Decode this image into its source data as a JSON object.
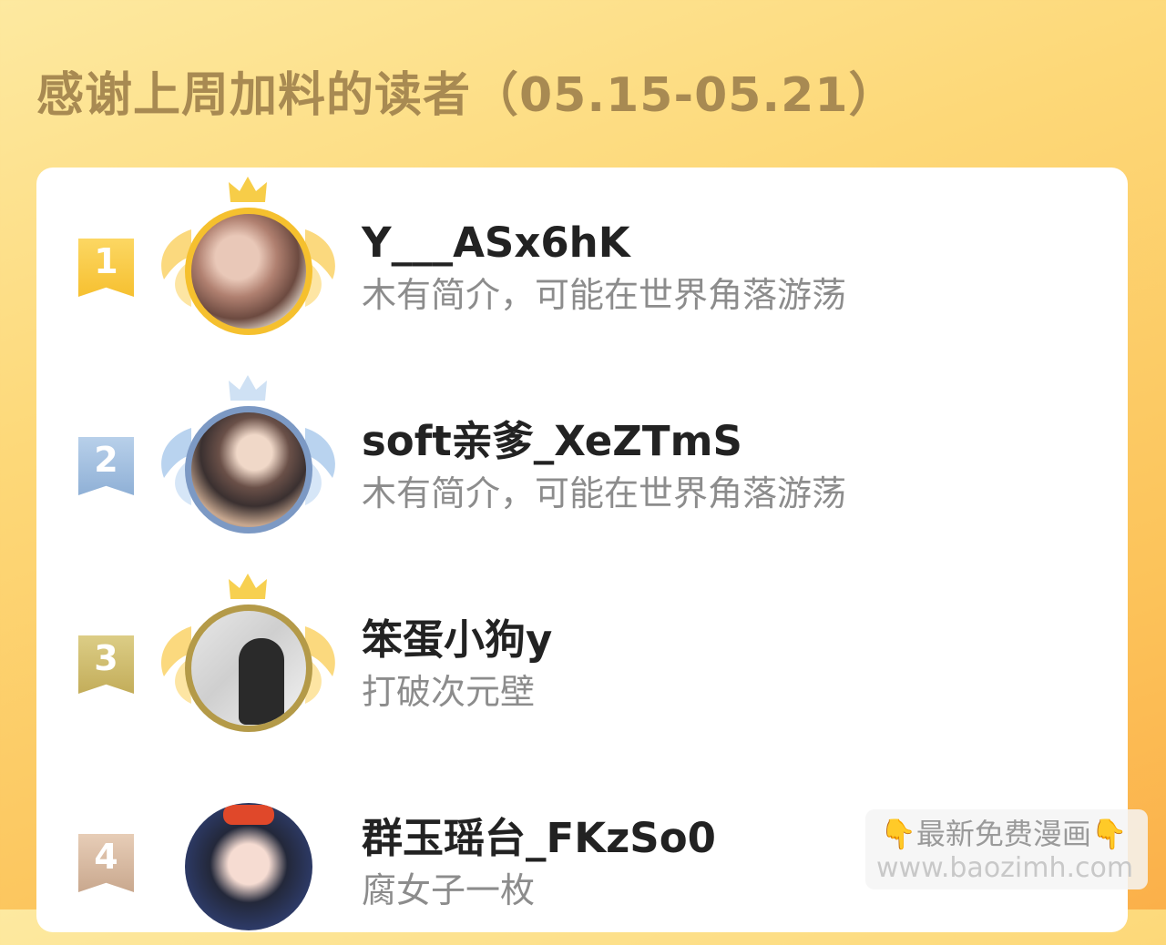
{
  "header": {
    "title": "感谢上周加料的读者（05.15-05.21）"
  },
  "readers": [
    {
      "rank": "1",
      "name": "Y___ASx6hK",
      "bio": "木有简介，可能在世界角落游荡"
    },
    {
      "rank": "2",
      "name": "soft亲爹_XeZTmS",
      "bio": "木有简介，可能在世界角落游荡"
    },
    {
      "rank": "3",
      "name": "笨蛋小狗y",
      "bio": "打破次元壁"
    },
    {
      "rank": "4",
      "name": "群玉瑶台_FKzSo0",
      "bio": "腐女子一枚"
    }
  ],
  "watermark": {
    "text": "最新免费漫画",
    "url": "www.baozimh.com",
    "icon": "pointing-down-hand-icon"
  },
  "colors": {
    "gold": "#f5c02e",
    "silver": "#8fb0d6",
    "bronze": "#c3ad5a",
    "fourth": "#c9a88e",
    "title": "#a88a52"
  }
}
